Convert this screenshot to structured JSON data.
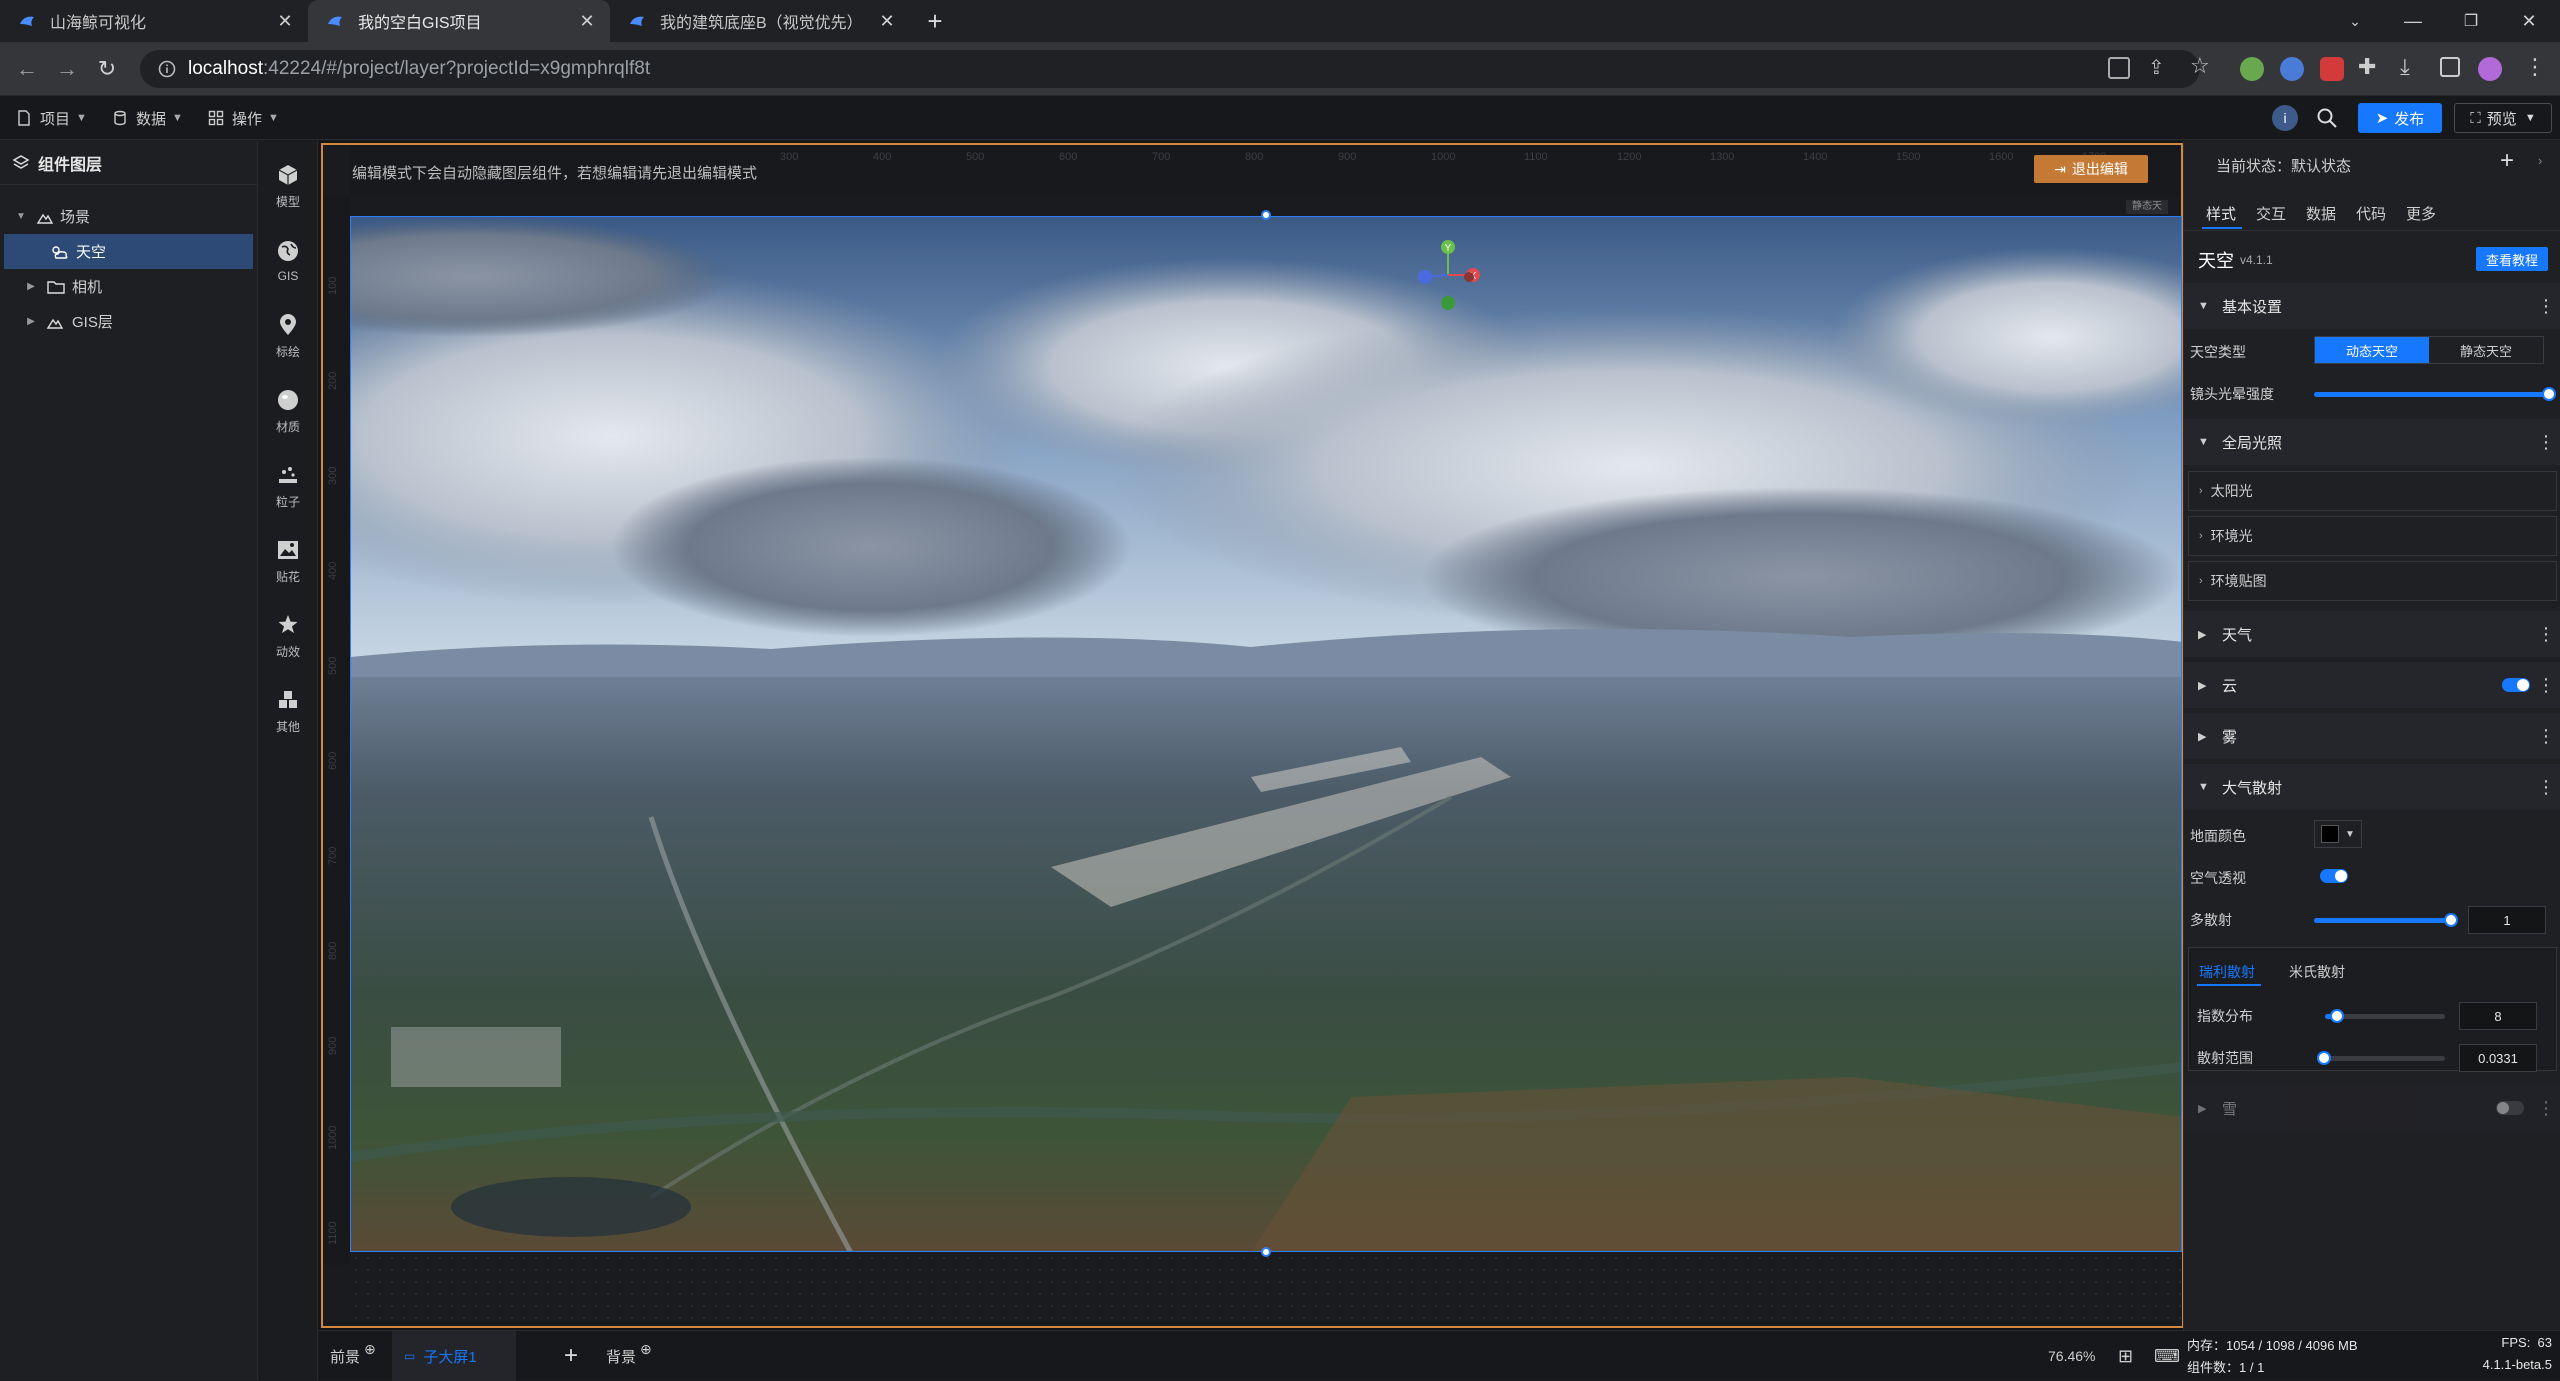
{
  "browser": {
    "tabs": [
      {
        "title": "山海鲸可视化",
        "active": false
      },
      {
        "title": "我的空白GIS项目",
        "active": true
      },
      {
        "title": "我的建筑底座B（视觉优先）",
        "active": false
      }
    ],
    "url_host": "localhost",
    "url_path": ":42224/#/project/layer?projectId=x9gmphrqlf8t"
  },
  "app_toolbar": {
    "menus": [
      {
        "label": "项目",
        "icon": "file-icon"
      },
      {
        "label": "数据",
        "icon": "database-icon"
      },
      {
        "label": "操作",
        "icon": "grid-icon"
      }
    ],
    "user_initial": "i",
    "publish_label": "发布",
    "preview_label": "预览"
  },
  "layer_panel": {
    "title": "组件图层",
    "items": [
      {
        "label": "场景",
        "indent": 0,
        "expanded": true,
        "selected": false
      },
      {
        "label": "天空",
        "indent": 1,
        "expanded": false,
        "selected": true
      },
      {
        "label": "相机",
        "indent": 1,
        "expanded": false,
        "selected": false
      },
      {
        "label": "GIS层",
        "indent": 1,
        "expanded": false,
        "selected": false
      }
    ]
  },
  "palette": {
    "items": [
      {
        "label": "模型",
        "icon": "cube-icon"
      },
      {
        "label": "GIS",
        "icon": "globe-icon"
      },
      {
        "label": "标绘",
        "icon": "map-pin-icon"
      },
      {
        "label": "材质",
        "icon": "sphere-icon"
      },
      {
        "label": "粒子",
        "icon": "particle-icon"
      },
      {
        "label": "贴花",
        "icon": "image-icon"
      },
      {
        "label": "动效",
        "icon": "star-icon"
      },
      {
        "label": "其他",
        "icon": "cubes-icon"
      }
    ]
  },
  "canvas": {
    "edit_hint": "编辑模式下会自动隐藏图层组件，若想编辑请先退出编辑模式",
    "exit_edit_label": "退出编辑",
    "corner_tag": "静态天",
    "ruler_top": [
      "300",
      "400",
      "500",
      "600",
      "700",
      "800",
      "900",
      "1000",
      "1100",
      "1200",
      "1300",
      "1400",
      "1500",
      "1600",
      "1700"
    ],
    "ruler_left": [
      "100",
      "200",
      "300",
      "400",
      "500",
      "600",
      "700",
      "800",
      "900",
      "1000",
      "1100"
    ],
    "gizmo": {
      "x_label": "X",
      "y_label": "Y"
    }
  },
  "bottom_bar": {
    "foreground_label": "前景",
    "screen_tab_label": "子大屏1",
    "background_label": "背景",
    "zoom": "76.46%"
  },
  "props": {
    "state_label": "当前状态：默认状态",
    "tabs": [
      "样式",
      "交互",
      "数据",
      "代码",
      "更多"
    ],
    "active_tab": 0,
    "component_name": "天空",
    "component_version": "v4.1.1",
    "tutorial_label": "查看教程",
    "basic": {
      "title": "基本设置",
      "sky_type_label": "天空类型",
      "sky_type_options": [
        "动态天空",
        "静态天空"
      ],
      "sky_type_selected": 0,
      "flare_label": "镜头光晕强度",
      "flare_value": 1.0
    },
    "global_light": {
      "title": "全局光照",
      "subs": [
        "太阳光",
        "环境光",
        "环境贴图"
      ]
    },
    "weather_title": "天气",
    "cloud_title": "云",
    "fog_title": "雾",
    "atmosphere": {
      "title": "大气散射",
      "ground_color_label": "地面颜色",
      "ground_color": "#000000",
      "air_perspective_label": "空气透视",
      "multi_scatter_label": "多散射",
      "multi_scatter_value": "1",
      "multi_scatter_fraction": 0.98,
      "tabs": [
        "瑞利散射",
        "米氏散射"
      ],
      "active_tab": 0,
      "exponent_label": "指数分布",
      "exponent_value": "8",
      "exponent_fraction": 0.1,
      "range_label": "散射范围",
      "range_value": "0.0331",
      "range_fraction": 0.03
    },
    "rain_title": "雪"
  },
  "status": {
    "memory": "内存：1054 / 1098 / 4096 MB",
    "components": "组件数：1 / 1",
    "fps": "FPS:  63",
    "version": "4.1.1-beta.5"
  },
  "colors": {
    "accent": "#1677ff",
    "canvas_border": "#d4883e",
    "exit_button": "#c47a35"
  }
}
